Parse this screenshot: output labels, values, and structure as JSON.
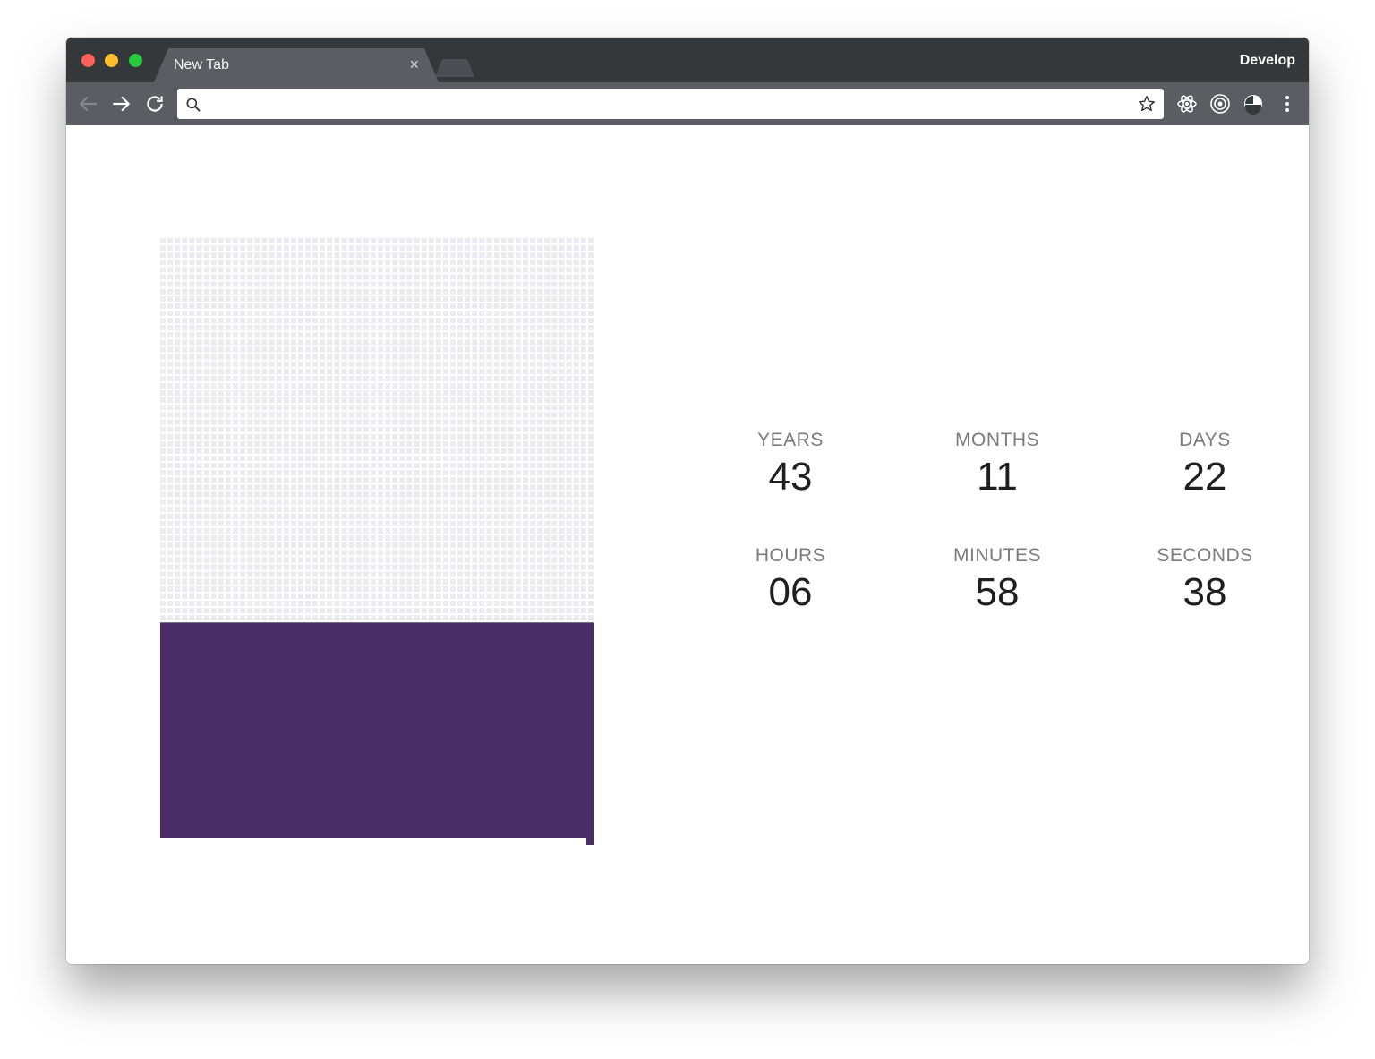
{
  "browser": {
    "tab": {
      "title": "New Tab",
      "close_glyph": "×"
    },
    "menu_label": "Develop",
    "address_bar": {
      "value": "",
      "placeholder": ""
    },
    "toolbar_icons": [
      "back-arrow-icon",
      "forward-arrow-icon",
      "reload-icon",
      "search-icon",
      "star-icon",
      "react-devtools-icon",
      "target-extension-icon",
      "clock-extension-icon",
      "more-vert-icon"
    ]
  },
  "life_grid": {
    "lived_color": "#4a2d68",
    "remaining_color": "#ebebf0",
    "lived_fraction": 0.366
  },
  "countdown": {
    "years": {
      "label": "YEARS",
      "value": "43"
    },
    "months": {
      "label": "MONTHS",
      "value": "11"
    },
    "days": {
      "label": "DAYS",
      "value": "22"
    },
    "hours": {
      "label": "HOURS",
      "value": "06"
    },
    "minutes": {
      "label": "MINUTES",
      "value": "58"
    },
    "seconds": {
      "label": "SECONDS",
      "value": "38"
    }
  }
}
